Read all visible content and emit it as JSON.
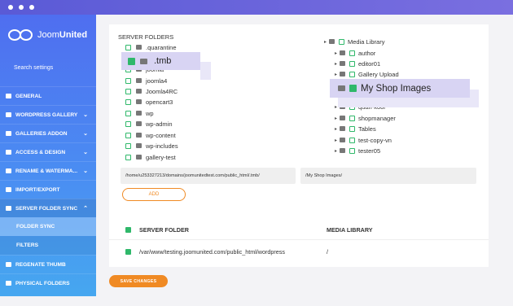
{
  "app": {
    "logo_text_1": "Joom",
    "logo_text_2": "United",
    "search_placeholder": "Search settings"
  },
  "sidebar": {
    "items": [
      {
        "label": "GENERAL"
      },
      {
        "label": "WORDPRESS GALLERY"
      },
      {
        "label": "GALLERIES ADDON"
      },
      {
        "label": "ACCESS & DESIGN"
      },
      {
        "label": "RENAME & WATERMA..."
      },
      {
        "label": "IMPORT/EXPORT"
      },
      {
        "label": "SERVER FOLDER SYNC"
      },
      {
        "label": "FOLDER SYNC"
      },
      {
        "label": "FILTERS"
      },
      {
        "label": "REGENATE THUMB"
      },
      {
        "label": "PHYSICAL FOLDERS"
      }
    ]
  },
  "server": {
    "header": "SERVER FOLDERS",
    "folders": [
      ".quarantine",
      ".tmb",
      "",
      "joomla4",
      "Joomla4RC",
      "opencart3",
      "wp",
      "wp-admin",
      "wp-content",
      "wp-includes",
      "gallery-test"
    ],
    "partial_label": "joomla"
  },
  "media": {
    "root": "Media Library",
    "folders": [
      "author",
      "editor01",
      "Gallery Upload",
      "My Shop Images",
      "quan-kool",
      "shopmanager",
      "Tables",
      "test-copy-vn",
      "tester05"
    ]
  },
  "popup_server": {
    "label": ".tmb"
  },
  "popup_media": {
    "label": "My Shop Images"
  },
  "paths": {
    "server_path": "/home/u253327213/domains/joomunitedtest.com/public_html/.tmb/",
    "media_path": "/My Shop Images/"
  },
  "buttons": {
    "add": "ADD",
    "save": "SAVE CHANGES"
  },
  "table": {
    "col1": "SERVER FOLDER",
    "col2": "MEDIA LIBRARY",
    "rows": [
      {
        "server": "/var/www/testing.joomunited.com/public_html/wordpress",
        "media": "/"
      }
    ]
  },
  "colors": {
    "accent": "#f08a24",
    "check": "#2fb86a",
    "sidebar_top": "#4f6ef0",
    "sidebar_bottom": "#46a7f0"
  }
}
